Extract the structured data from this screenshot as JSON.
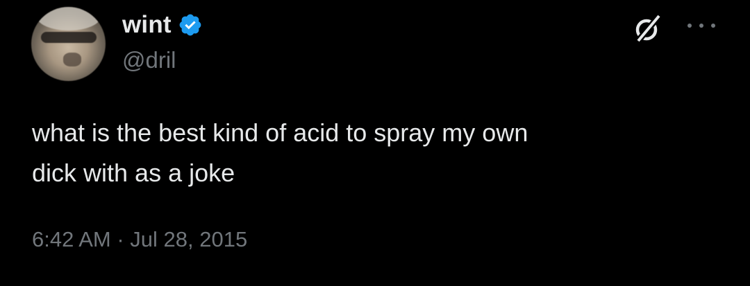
{
  "tweet": {
    "author": {
      "display_name": "wint",
      "handle": "@dril",
      "verified": true,
      "avatar_icon": "profile-photo"
    },
    "text": "what is the best kind of acid to spray my own\ndick with as a joke",
    "timestamp": "6:42 AM · Jul 28, 2015",
    "icons": {
      "grok": "grok-icon",
      "more": "more-icon"
    }
  },
  "colors": {
    "background": "#000000",
    "primary_text": "#e7e9ea",
    "secondary_text": "#71767b",
    "verified_blue": "#1d9bf0"
  }
}
